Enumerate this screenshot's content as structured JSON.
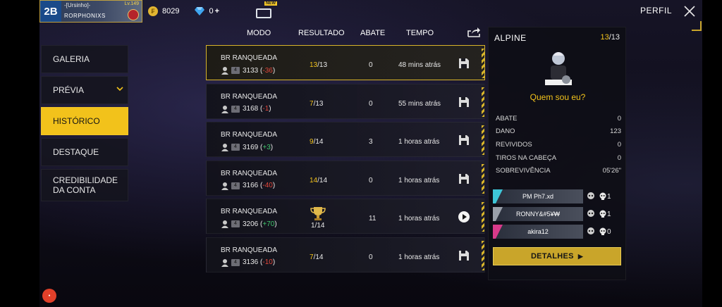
{
  "topbar": {
    "guild_text": "-[Ursinho]-",
    "player_name": "RORPHONIXS",
    "level_text": "Lv.149",
    "avatar_text": "2B",
    "coins": "8029",
    "diamonds": "0",
    "plus": "+",
    "store_badge": "NEW"
  },
  "header": {
    "perfil": "PERFIL"
  },
  "menu": [
    {
      "label": "GALERIA"
    },
    {
      "label": "PRÉVIA"
    },
    {
      "label": "HISTÓRICO",
      "active": true
    },
    {
      "label": "DESTAQUE"
    },
    {
      "label": "CREDIBILIDADE\nDA CONTA"
    }
  ],
  "table": {
    "columns": [
      "MODO",
      "RESULTADO",
      "ABATE",
      "TEMPO"
    ],
    "rows": [
      {
        "mode": "BR RANQUEADA",
        "tier": "4",
        "points": "3133",
        "delta": "-36",
        "delta_sign": "neg",
        "result_pos": "13",
        "result_total": "/13",
        "kills": "0",
        "time": "48 mins atrás",
        "action": "save"
      },
      {
        "mode": "BR RANQUEADA",
        "tier": "4",
        "points": "3168",
        "delta": "-1",
        "delta_sign": "neg",
        "result_pos": "7",
        "result_total": "/13",
        "kills": "0",
        "time": "55 mins atrás",
        "action": "save"
      },
      {
        "mode": "BR RANQUEADA",
        "tier": "4",
        "points": "3169",
        "delta": "+3",
        "delta_sign": "pos",
        "result_pos": "9",
        "result_total": "/14",
        "kills": "3",
        "time": "1 horas atrás",
        "action": "save"
      },
      {
        "mode": "BR RANQUEADA",
        "tier": "4",
        "points": "3166",
        "delta": "-40",
        "delta_sign": "neg",
        "result_pos": "14",
        "result_total": "/14",
        "kills": "0",
        "time": "1 horas atrás",
        "action": "save"
      },
      {
        "mode": "BR RANQUEADA",
        "tier": "4",
        "points": "3206",
        "delta": "+70",
        "delta_sign": "pos",
        "result_pos": "1",
        "result_total": "/14",
        "kills": "11",
        "time": "1 horas atrás",
        "action": "play",
        "trophy": true
      },
      {
        "mode": "BR RANQUEADA",
        "tier": "4",
        "points": "3136",
        "delta": "-10",
        "delta_sign": "neg",
        "result_pos": "7",
        "result_total": "/14",
        "kills": "0",
        "time": "1 horas atrás",
        "action": "save"
      }
    ]
  },
  "panel": {
    "map": "ALPINE",
    "pos": "13",
    "total": "/13",
    "who_label": "Quem sou eu?",
    "stats": [
      {
        "label": "ABATE",
        "value": "0"
      },
      {
        "label": "DANO",
        "value": "123"
      },
      {
        "label": "REVIVIDOS",
        "value": "0"
      },
      {
        "label": "TIROS NA CABEÇA",
        "value": "0"
      },
      {
        "label": "SOBREVIVÊNCIA",
        "value": "05'26\""
      }
    ],
    "team": [
      {
        "name": "PM    Ph7.xd",
        "kills": "1",
        "color": "#3ec6d8"
      },
      {
        "name": "RONNY&#5¥₩",
        "kills": "1",
        "color": "#9aa0aa"
      },
      {
        "name": "akira12",
        "kills": "0",
        "color": "#d83a8a"
      }
    ],
    "details": "DETALHES"
  },
  "colors": {
    "accent": "#f2c21b",
    "negative": "#e2473b",
    "positive": "#41c46d"
  }
}
